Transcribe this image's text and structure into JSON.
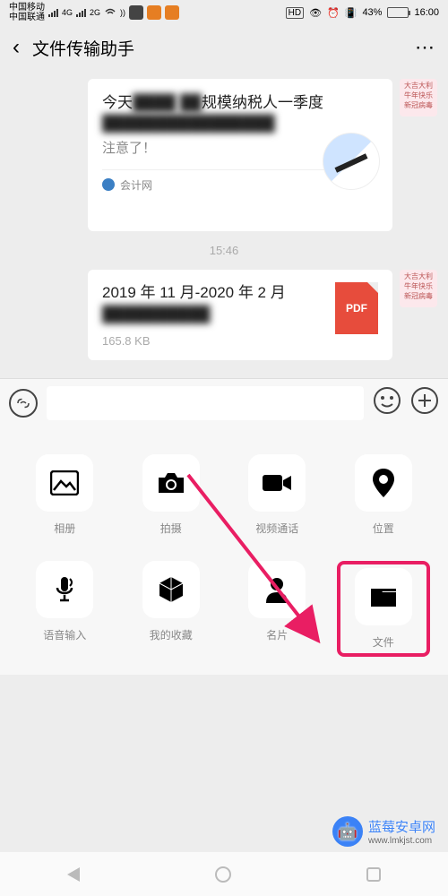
{
  "status": {
    "carrier1": "中国移动",
    "carrier2": "中国联通",
    "net1": "4G",
    "net2": "2G",
    "hd": "HD",
    "battery_pct": "43%",
    "time": "16:00"
  },
  "header": {
    "title": "文件传输助手"
  },
  "chat": {
    "article": {
      "line1a": "今天",
      "line1b": "规模纳税人一季度",
      "line3": "注意了！",
      "source": "会计网"
    },
    "timestamp": "15:46",
    "file": {
      "title": "2019 年 11 月-2020 年 2 月",
      "size": "165.8 KB",
      "ext": "PDF"
    },
    "avatar_text": "大吉大利\n牛年快乐\n新冠病毒"
  },
  "attach": {
    "items": [
      {
        "label": "相册",
        "icon": "gallery"
      },
      {
        "label": "拍摄",
        "icon": "camera"
      },
      {
        "label": "视频通话",
        "icon": "video"
      },
      {
        "label": "位置",
        "icon": "location"
      },
      {
        "label": "语音输入",
        "icon": "mic"
      },
      {
        "label": "我的收藏",
        "icon": "cube"
      },
      {
        "label": "名片",
        "icon": "person"
      },
      {
        "label": "文件",
        "icon": "folder"
      }
    ]
  },
  "watermark": {
    "name": "蓝莓安卓网",
    "url": "www.lmkjst.com"
  }
}
